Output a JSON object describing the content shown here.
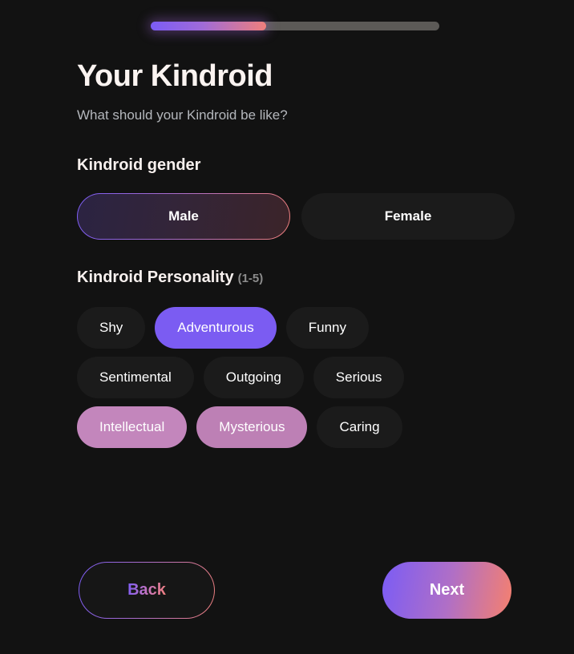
{
  "progress": {
    "percent": 40,
    "fill_start_color": "#7b5cf5",
    "fill_end_color": "#ef7f7c",
    "track_color": "#5c5a57"
  },
  "header": {
    "title": "Your Kindroid",
    "subtitle": "What should your Kindroid be like?"
  },
  "gender": {
    "label": "Kindroid gender",
    "options": [
      {
        "label": "Male",
        "selected": true
      },
      {
        "label": "Female",
        "selected": false
      }
    ]
  },
  "personality": {
    "label": "Kindroid Personality",
    "hint": "(1-5)",
    "rows": [
      [
        {
          "label": "Shy",
          "selected": false
        },
        {
          "label": "Adventurous",
          "selected": true,
          "color": "#7b5cf2"
        },
        {
          "label": "Funny",
          "selected": false
        }
      ],
      [
        {
          "label": "Sentimental",
          "selected": false
        },
        {
          "label": "Outgoing",
          "selected": false
        },
        {
          "label": "Serious",
          "selected": false
        }
      ],
      [
        {
          "label": "Intellectual",
          "selected": true,
          "color": "#c386bc"
        },
        {
          "label": "Mysterious",
          "selected": true,
          "color": "#bd80b5"
        },
        {
          "label": "Caring",
          "selected": false
        }
      ]
    ]
  },
  "footer": {
    "back_label": "Back",
    "next_label": "Next"
  }
}
